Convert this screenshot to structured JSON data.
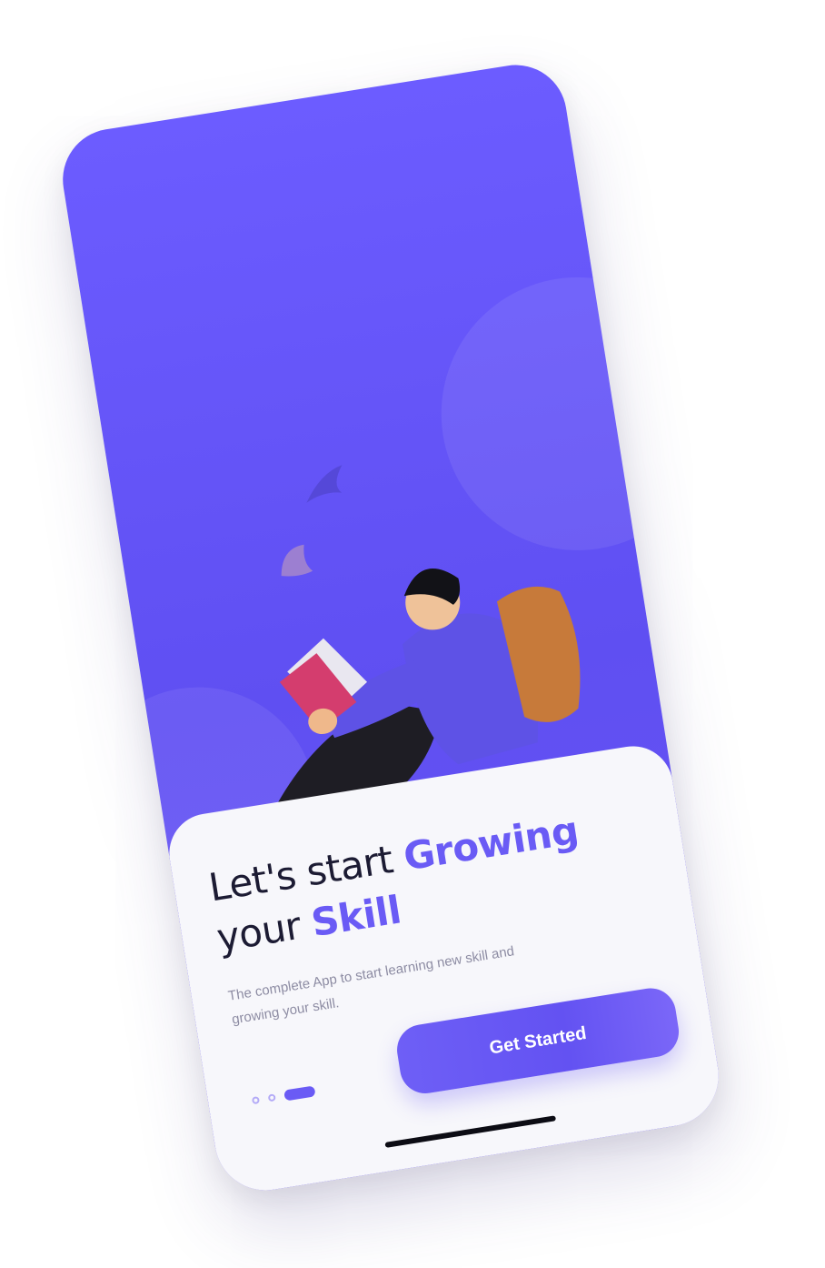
{
  "onboarding": {
    "headline": {
      "line1_plain": "Let's start ",
      "line1_highlight": "Growing",
      "line2_plain": "your ",
      "line2_highlight": "Skill"
    },
    "subtitle": "The complete App to start learning new skill and growing your skill.",
    "cta_label": "Get Started",
    "pager": {
      "total": 3,
      "active_index": 2
    },
    "illustration": "person-reading-book-with-backpack-illustration"
  },
  "colors": {
    "primary": "#6a5bf5",
    "background_gradient_top": "#6c5cff",
    "card": "#f7f7fb",
    "headline_text": "#1c1b33",
    "subtitle_text": "#8d8ca3"
  }
}
